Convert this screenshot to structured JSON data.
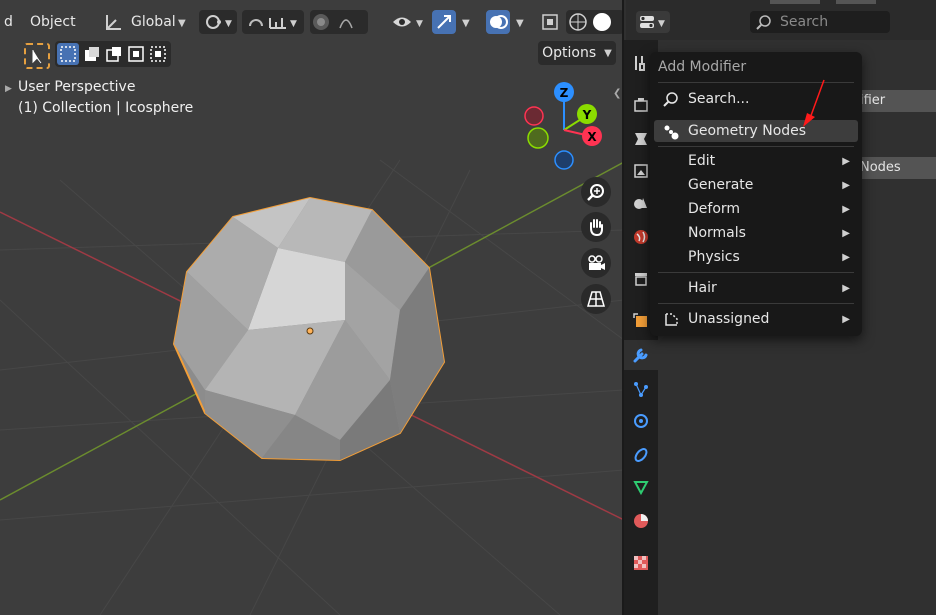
{
  "top_header": {
    "cut_label": "d",
    "mode_label": "Object",
    "transform_orientation": "Global",
    "options_label": "Options"
  },
  "viewport": {
    "perspective_label": "User Perspective",
    "collection_label": "(1) Collection | Icosphere",
    "gizmo": {
      "z": "Z",
      "y": "Y",
      "x": "X"
    }
  },
  "properties": {
    "search_placeholder": "Search",
    "add_modifier_partial": "ifier",
    "modifier_name_partial": "Nodes"
  },
  "add_modifier_menu": {
    "title": "Add Modifier",
    "items": [
      {
        "label": "Search...",
        "icon": "search-icon",
        "submenu": false
      },
      {
        "label": "Geometry Nodes",
        "icon": "geometry-nodes-icon",
        "submenu": false,
        "highlighted": true
      },
      {
        "label": "Edit",
        "submenu": true
      },
      {
        "label": "Generate",
        "submenu": true
      },
      {
        "label": "Deform",
        "submenu": true
      },
      {
        "label": "Normals",
        "submenu": true
      },
      {
        "label": "Physics",
        "submenu": true
      },
      {
        "label": "Hair",
        "submenu": true
      },
      {
        "label": "Unassigned",
        "icon": "unassigned-icon",
        "submenu": true
      }
    ]
  },
  "colors": {
    "accent_blue": "#4772b3",
    "selection_orange": "#f29e38",
    "annotation_red": "#ff1a1a",
    "x_axis": "#ff3352",
    "y_axis": "#8bdc00",
    "z_axis": "#2c8fff"
  }
}
